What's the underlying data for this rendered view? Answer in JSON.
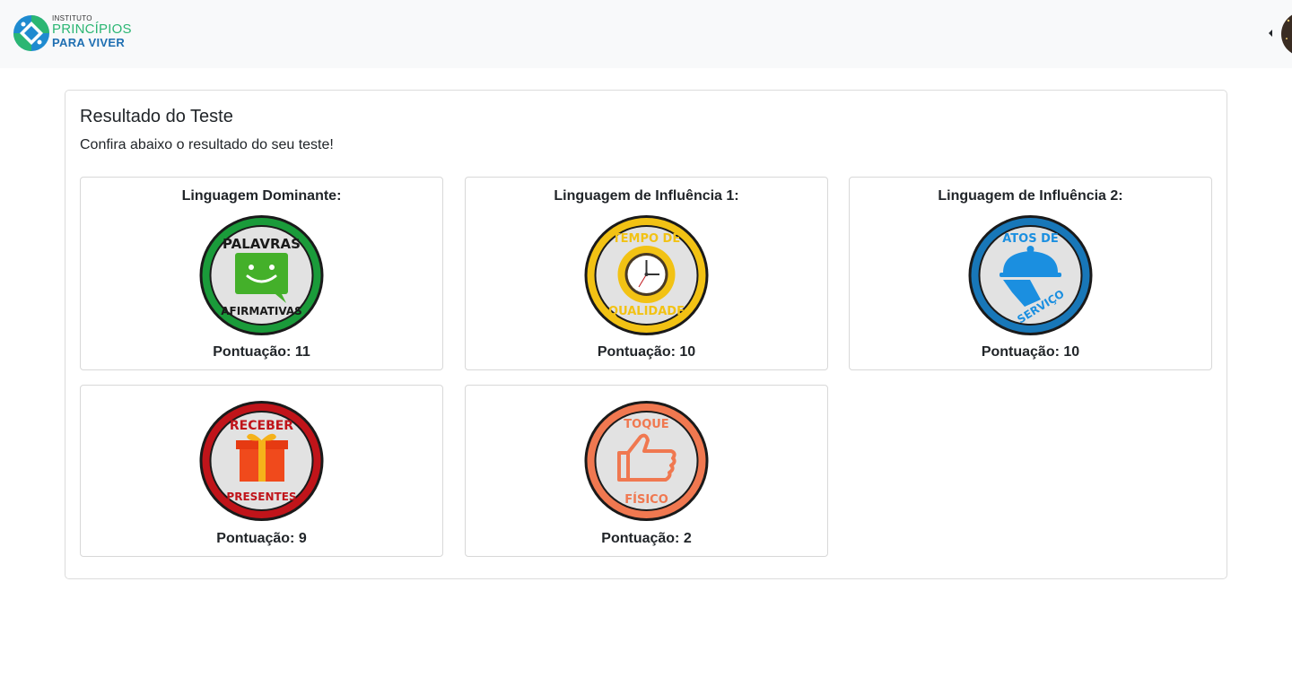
{
  "brand": {
    "line1": "INSTITUTO",
    "line2": "PRINCÍPIOS",
    "line3": "PARA VIVER"
  },
  "page": {
    "title": "Resultado do Teste",
    "subtitle": "Confira abaixo o resultado do seu teste!"
  },
  "results": [
    {
      "label": "Linguagem Dominante:",
      "badge_top": "PALAVRAS",
      "badge_bottom": "AFIRMATIVAS",
      "score": "Pontuação: 11",
      "color": "#1a9b3a"
    },
    {
      "label": "Linguagem de Influência 1:",
      "badge_top": "TEMPO DE",
      "badge_bottom": "QUALIDADE",
      "score": "Pontuação: 10",
      "color": "#f2c214"
    },
    {
      "label": "Linguagem de Influência 2:",
      "badge_top": "ATOS DE",
      "badge_bottom": "SERVIÇO",
      "score": "Pontuação: 10",
      "color": "#1877b8"
    },
    {
      "label": "",
      "badge_top": "RECEBER",
      "badge_bottom": "PRESENTES",
      "score": "Pontuação: 9",
      "color": "#c0141a"
    },
    {
      "label": "",
      "badge_top": "TOQUE",
      "badge_bottom": "FÍSICO",
      "score": "Pontuação: 2",
      "color": "#f07850"
    }
  ]
}
